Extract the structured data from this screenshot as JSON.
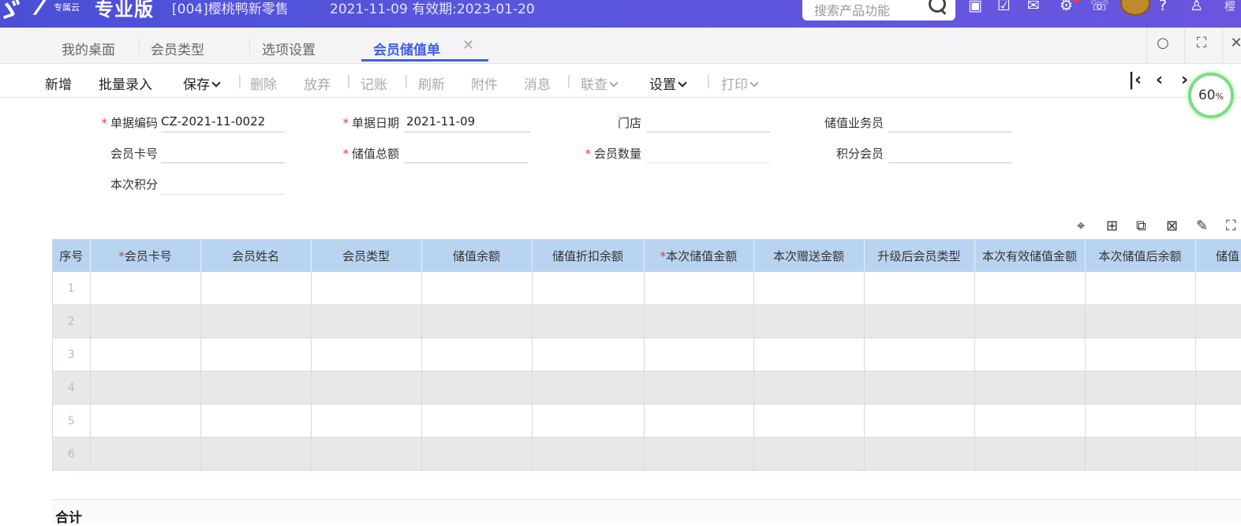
{
  "header": {
    "brand_sub": "专属云",
    "brand_title": "专业版",
    "company": "[004]樱桃鸭新零售",
    "date_info": "2021-11-09  有效期:2023-01-20",
    "search_placeholder": "搜索产品功能",
    "user_fragment": "樱"
  },
  "tabs": [
    {
      "label": "我的桌面"
    },
    {
      "label": "会员类型"
    },
    {
      "label": "选项设置"
    },
    {
      "label": "会员储值单",
      "active": true
    }
  ],
  "toolbar": {
    "items": [
      {
        "label": "新增",
        "enabled": true
      },
      {
        "label": "批量录入",
        "enabled": true
      },
      {
        "label": "保存",
        "enabled": true,
        "dropdown": true
      },
      {
        "label": "删除",
        "enabled": false
      },
      {
        "label": "放弃",
        "enabled": false
      },
      {
        "label": "记账",
        "enabled": false
      },
      {
        "label": "刷新",
        "enabled": false
      },
      {
        "label": "附件",
        "enabled": false
      },
      {
        "label": "消息",
        "enabled": false
      },
      {
        "label": "联查",
        "enabled": false,
        "dropdown": true
      },
      {
        "label": "设置",
        "enabled": true,
        "dropdown": true
      },
      {
        "label": "打印",
        "enabled": false,
        "dropdown": true
      }
    ],
    "zoom": "60",
    "zoom_unit": "%"
  },
  "form": {
    "doc_no_label": "单据编码",
    "doc_no_value": "CZ-2021-11-0022",
    "doc_date_label": "单据日期",
    "doc_date_value": "2021-11-09",
    "store_label": "门店",
    "store_value": "",
    "salesperson_label": "储值业务员",
    "salesperson_value": "",
    "card_label": "会员卡号",
    "card_value": "",
    "total_label": "储值总额",
    "total_value": "",
    "count_label": "会员数量",
    "count_value": "",
    "points_member_label": "积分会员",
    "points_member_value": "",
    "points_label": "本次积分",
    "points_value": ""
  },
  "grid": {
    "columns": [
      {
        "label": "序号",
        "required": false
      },
      {
        "label": "会员卡号",
        "required": true
      },
      {
        "label": "会员姓名",
        "required": false
      },
      {
        "label": "会员类型",
        "required": false
      },
      {
        "label": "储值余额",
        "required": false
      },
      {
        "label": "储值折扣余额",
        "required": false
      },
      {
        "label": "本次储值金额",
        "required": true
      },
      {
        "label": "本次赠送金额",
        "required": false
      },
      {
        "label": "升级后会员类型",
        "required": false
      },
      {
        "label": "本次有效储值金额",
        "required": false
      },
      {
        "label": "本次储值后余额",
        "required": false
      },
      {
        "label": "储值",
        "required": false
      }
    ],
    "rows": [
      "1",
      "2",
      "3",
      "4",
      "5",
      "6"
    ]
  },
  "footer": {
    "total_label": "合计"
  },
  "colors": {
    "header_bg": "#5356dc",
    "accent": "#3f5ee8",
    "grid_header": "#b9d4f1",
    "required": "#e23b3b",
    "zoom_ring": "#7ddc86"
  }
}
